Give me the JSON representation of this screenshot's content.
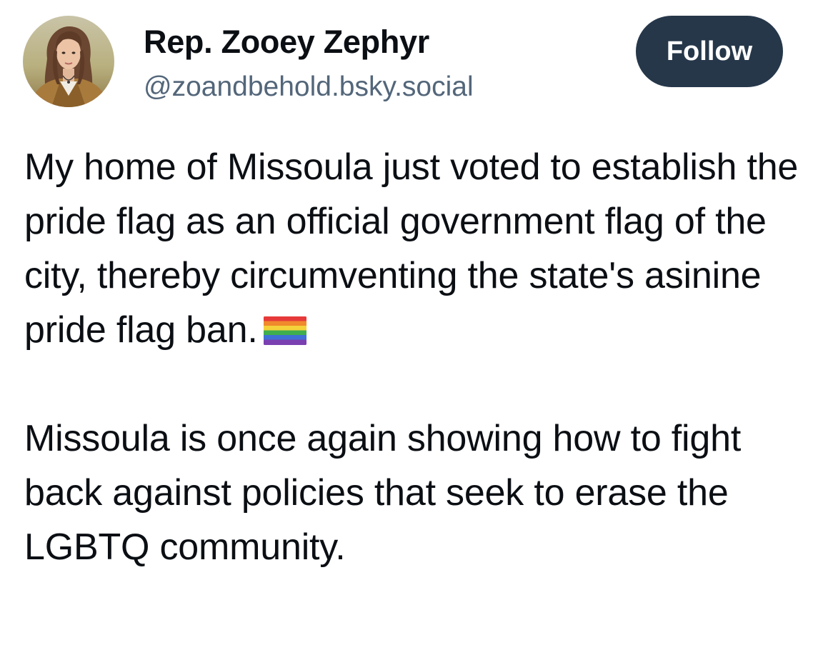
{
  "author": {
    "display_name": "Rep. Zooey Zephyr",
    "handle": "@zoandbehold.bsky.social"
  },
  "follow_button": {
    "label": "Follow"
  },
  "post": {
    "paragraph_1_text": "My home of Missoula just voted to establish the pride flag as an official government flag of the city, thereby circumventing the state's asinine pride flag ban.",
    "paragraph_1_emoji": "rainbow-flag",
    "paragraph_2_text": "Missoula is once again showing how to fight back against policies that seek to erase the LGBTQ community."
  },
  "colors": {
    "follow_button_bg": "#26374a",
    "handle_text": "#53667a",
    "body_text": "#0b0f14"
  }
}
